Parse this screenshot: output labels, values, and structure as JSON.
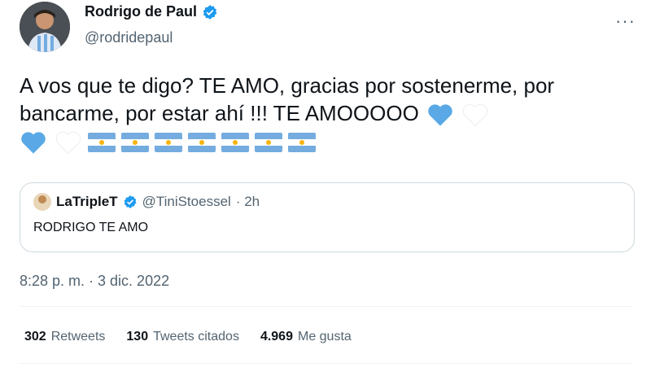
{
  "author": {
    "name": "Rodrigo de Paul",
    "handle": "@rodridepaul"
  },
  "tweet": {
    "text": "A vos que te digo? TE AMO, gracias por sostenerme, por bancarme, por estar ahí !!! TE AMOOOOO",
    "emoji": [
      "blue-heart",
      "white-heart",
      "blue-heart",
      "white-heart",
      "argentina-flag x7"
    ],
    "timestamp": "8:28 p. m. · 3 dic. 2022"
  },
  "quoted": {
    "name": "LaTripleT",
    "handle": "@TiniStoessel",
    "time": "· 2h",
    "text": "RODRIGO TE AMO"
  },
  "stats": [
    {
      "count": "302",
      "label": "Retweets"
    },
    {
      "count": "130",
      "label": "Tweets citados"
    },
    {
      "count": "4.969",
      "label": "Me gusta"
    }
  ],
  "colors": {
    "verified": "#1d9bf0",
    "blue_heart": "#5aa9e6",
    "muted": "#536471"
  },
  "more_icon": "more-horizontal-icon"
}
